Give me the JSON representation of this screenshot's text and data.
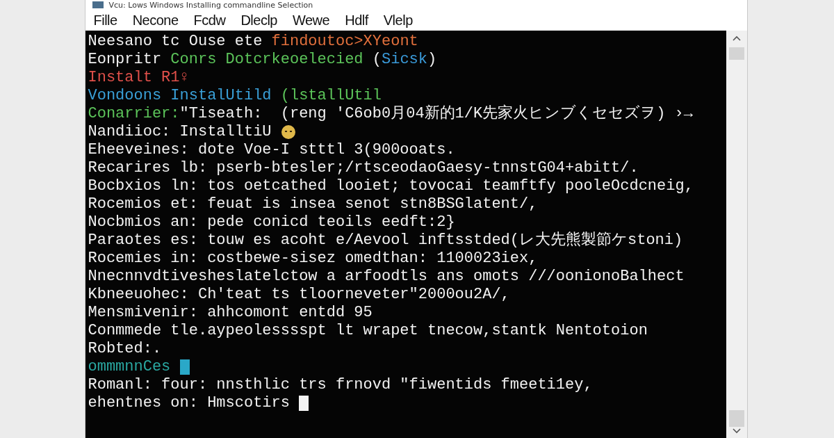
{
  "window": {
    "title": "Vcu: Lows Windows Installing commandline Selection"
  },
  "menu": [
    "Fille",
    "Necone",
    "Fcdw",
    "Dleclp",
    "Wewe",
    "Hdlf",
    "Vlelp"
  ],
  "terminal": {
    "lines": [
      [
        {
          "kind": "text",
          "text": "Neesano tc Ouse ete ",
          "color": "#f2f2f2"
        },
        {
          "kind": "text",
          "text": "findoutoc>XYeont",
          "color": "#e2703c"
        }
      ],
      [
        {
          "kind": "text",
          "text": "Eonpritr ",
          "color": "#f2f2f2"
        },
        {
          "kind": "text",
          "text": "Conrs Dotcrkeoelecied ",
          "color": "#5cc45a"
        },
        {
          "kind": "text",
          "text": "(",
          "color": "#f2f2f2"
        },
        {
          "kind": "text",
          "text": "Sicsk",
          "color": "#3a9ad9"
        },
        {
          "kind": "text",
          "text": ")",
          "color": "#f2f2f2"
        }
      ],
      [
        {
          "kind": "text",
          "text": "Instalt R1♀",
          "color": "#e0504a"
        }
      ],
      [
        {
          "kind": "text",
          "text": "Vondoons InstalUtild ",
          "color": "#3aa0d8"
        },
        {
          "kind": "text",
          "text": "(lstallUtil",
          "color": "#5cc45a"
        }
      ],
      [
        {
          "kind": "text",
          "text": "Conarrier:",
          "color": "#5cc45a"
        },
        {
          "kind": "text",
          "text": "\"Tiseath:  (reng 'C6ob0月04新的1/K先家火ヒンブくセセズヲ) ›→",
          "color": "#f2f2f2"
        }
      ],
      [
        {
          "kind": "text",
          "text": "Nandiioc: InstalltiU ",
          "color": "#f2f2f2"
        },
        {
          "kind": "icon",
          "color": "#e0b84a"
        }
      ],
      [
        {
          "kind": "text",
          "text": "Eheeveines: dote Voe-I stttl 3(900ooats.",
          "color": "#f2f2f2"
        }
      ],
      [
        {
          "kind": "text",
          "text": "Recarires lb: pserb-btesler;/rtsceodaoGaesy-tnnstG04+abitt/.",
          "color": "#f2f2f2"
        }
      ],
      [
        {
          "kind": "text",
          "text": "Bocbxios ln: tos oetcathed looiet; tovocai teamftfy pooleOcdcneig,",
          "color": "#f2f2f2"
        }
      ],
      [
        {
          "kind": "text",
          "text": "Rocemios et: feuat is insea senot stn8BSGlatent/,",
          "color": "#f2f2f2"
        }
      ],
      [
        {
          "kind": "text",
          "text": "Nocbmios an: pede conicd teoils eedft:2}",
          "color": "#f2f2f2"
        }
      ],
      [
        {
          "kind": "text",
          "text": "Paraotes es: touw es acoht e/Aevool inftsstded(レ大先熊製節ケstoni)",
          "color": "#f2f2f2"
        }
      ],
      [
        {
          "kind": "text",
          "text": "Rocemies in: costbewe-sisez omedthan: 1100023iex,",
          "color": "#f2f2f2"
        }
      ],
      [
        {
          "kind": "text",
          "text": "Nnecnnvdtivesheslatelctow a arfoodtls ans omots ///oonionoBalhect",
          "color": "#f2f2f2"
        }
      ],
      [
        {
          "kind": "text",
          "text": "Kbneeuohec: Ch'teat ts tloorneveter\"2000ou2A/,",
          "color": "#f2f2f2"
        }
      ],
      [
        {
          "kind": "text",
          "text": "Mensmivenir: ahhcomont entdd 95",
          "color": "#f2f2f2"
        }
      ],
      [
        {
          "kind": "text",
          "text": "Conmmede tle.aypeolesssspt lt wrapet tnecow,stantk Nentotoion",
          "color": "#f2f2f2"
        }
      ],
      [
        {
          "kind": "text",
          "text": "Robted:.",
          "color": "#f2f2f2"
        }
      ],
      [
        {
          "kind": "text",
          "text": "ommmnnCes ",
          "color": "#2aa8a2"
        },
        {
          "kind": "cursor",
          "color": "#2aa8c8"
        }
      ],
      [
        {
          "kind": "text",
          "text": "Romanl: four: nnsthlic trs frnovd \"fiwentids fmeeti1ey,",
          "color": "#f2f2f2"
        }
      ],
      [
        {
          "kind": "text",
          "text": "ehentnes on: Hmscotirs ",
          "color": "#f2f2f2"
        },
        {
          "kind": "cursor",
          "color": "#f4f4f4"
        }
      ]
    ]
  }
}
